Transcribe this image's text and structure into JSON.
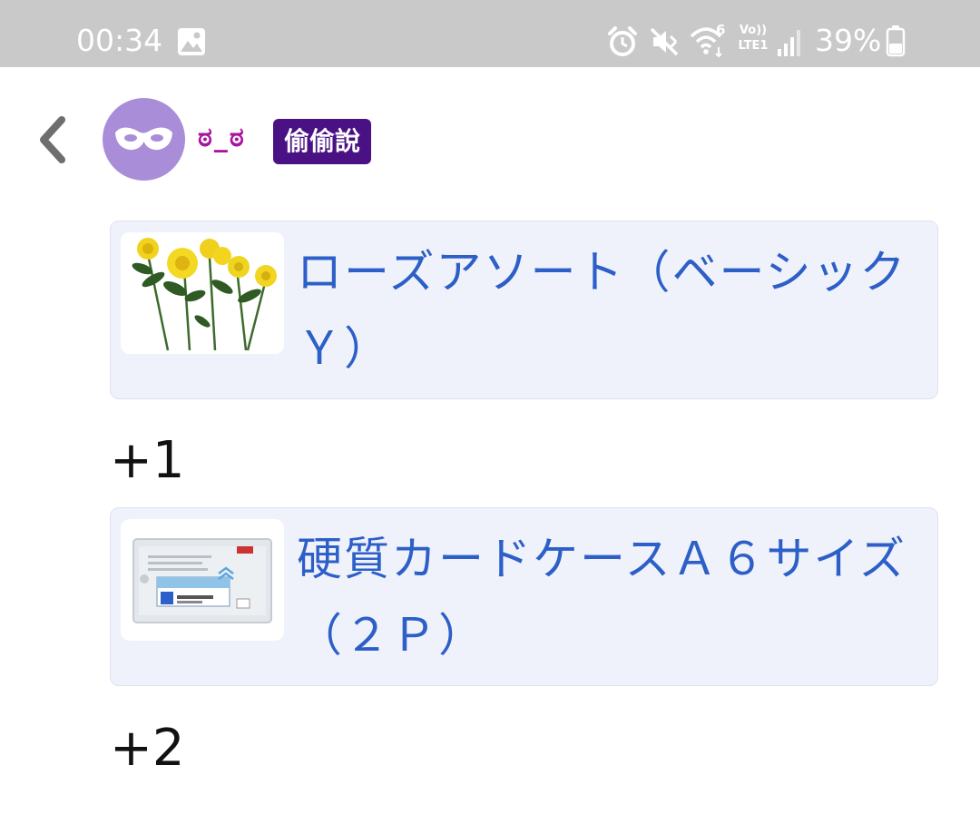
{
  "status_bar": {
    "time": "00:34",
    "battery_percent": "39%",
    "volte_line1": "Vo))",
    "volte_line2": "LTE1",
    "wifi_badge": "6",
    "icons": [
      "image-icon",
      "alarm-icon",
      "mute-icon",
      "wifi-icon",
      "volte-icon",
      "signal-icon",
      "battery-icon"
    ]
  },
  "header": {
    "username": "ಠ_ಠ",
    "badge": "偷偷說",
    "avatar_icon": "mask-icon",
    "back_icon": "chevron-left-icon"
  },
  "items": [
    {
      "title": "ローズアソート（ベーシックＹ）",
      "thumb_icon": "yellow-roses-image",
      "count": "+1"
    },
    {
      "title": "硬質カードケースＡ６サイズ（２Ｐ）",
      "thumb_icon": "card-case-image",
      "count": "+2"
    }
  ],
  "colors": {
    "status_bar_bg": "#c9c9c9",
    "link": "#2c5fc7",
    "card_bg": "#f0f2fb",
    "badge_bg": "#4a1185",
    "username": "#a7149f",
    "avatar_bg": "#a98dd8"
  }
}
